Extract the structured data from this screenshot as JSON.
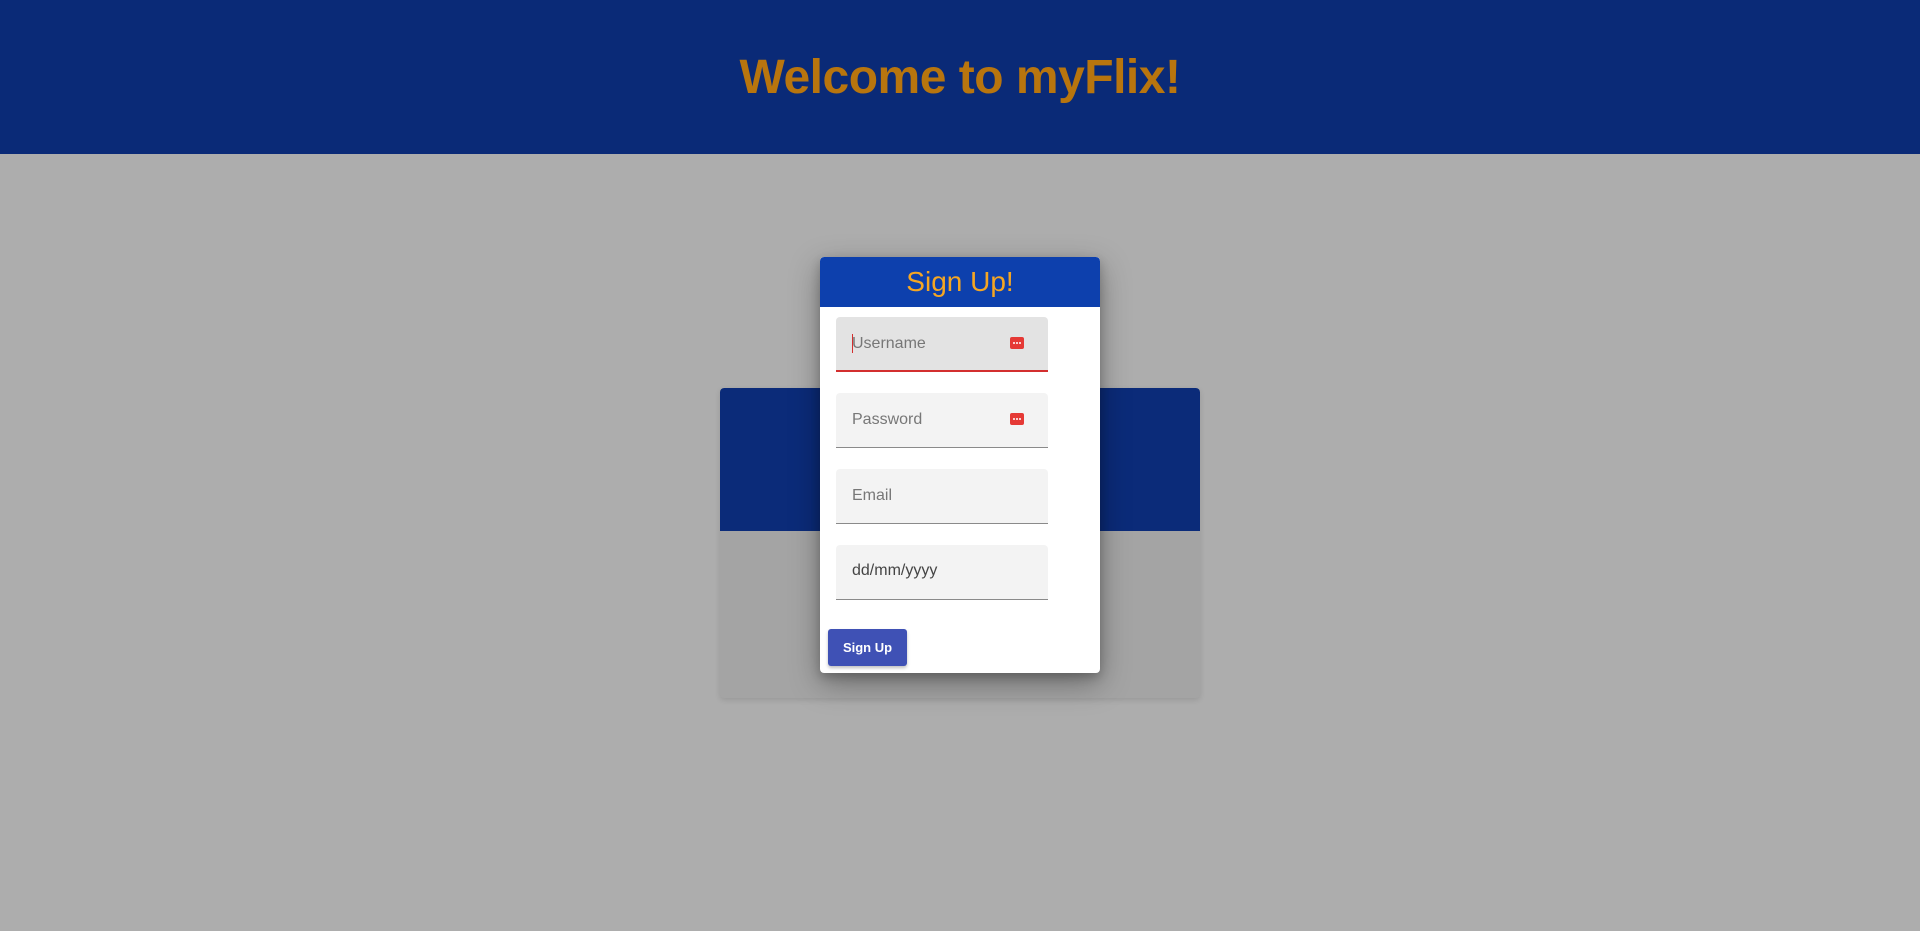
{
  "header": {
    "title": "Welcome to myFlix!",
    "background_color": "#0a2a77",
    "title_color": "#b8750e"
  },
  "signup_modal": {
    "title": "Sign Up!",
    "header_color": "#0d40ad",
    "title_color": "#f5a623",
    "fields": {
      "username": {
        "placeholder": "Username",
        "value": "",
        "state": "focused-invalid",
        "icon": "password-manager-key-icon"
      },
      "password": {
        "placeholder": "Password",
        "value": "",
        "icon": "password-manager-key-icon"
      },
      "email": {
        "placeholder": "Email",
        "value": ""
      },
      "birthday": {
        "placeholder": "dd/mm/yyyy",
        "value": ""
      }
    },
    "submit_label": "Sign Up",
    "submit_color": "#3f51b5"
  },
  "background_card": {
    "header_color": "#0b2b79"
  }
}
